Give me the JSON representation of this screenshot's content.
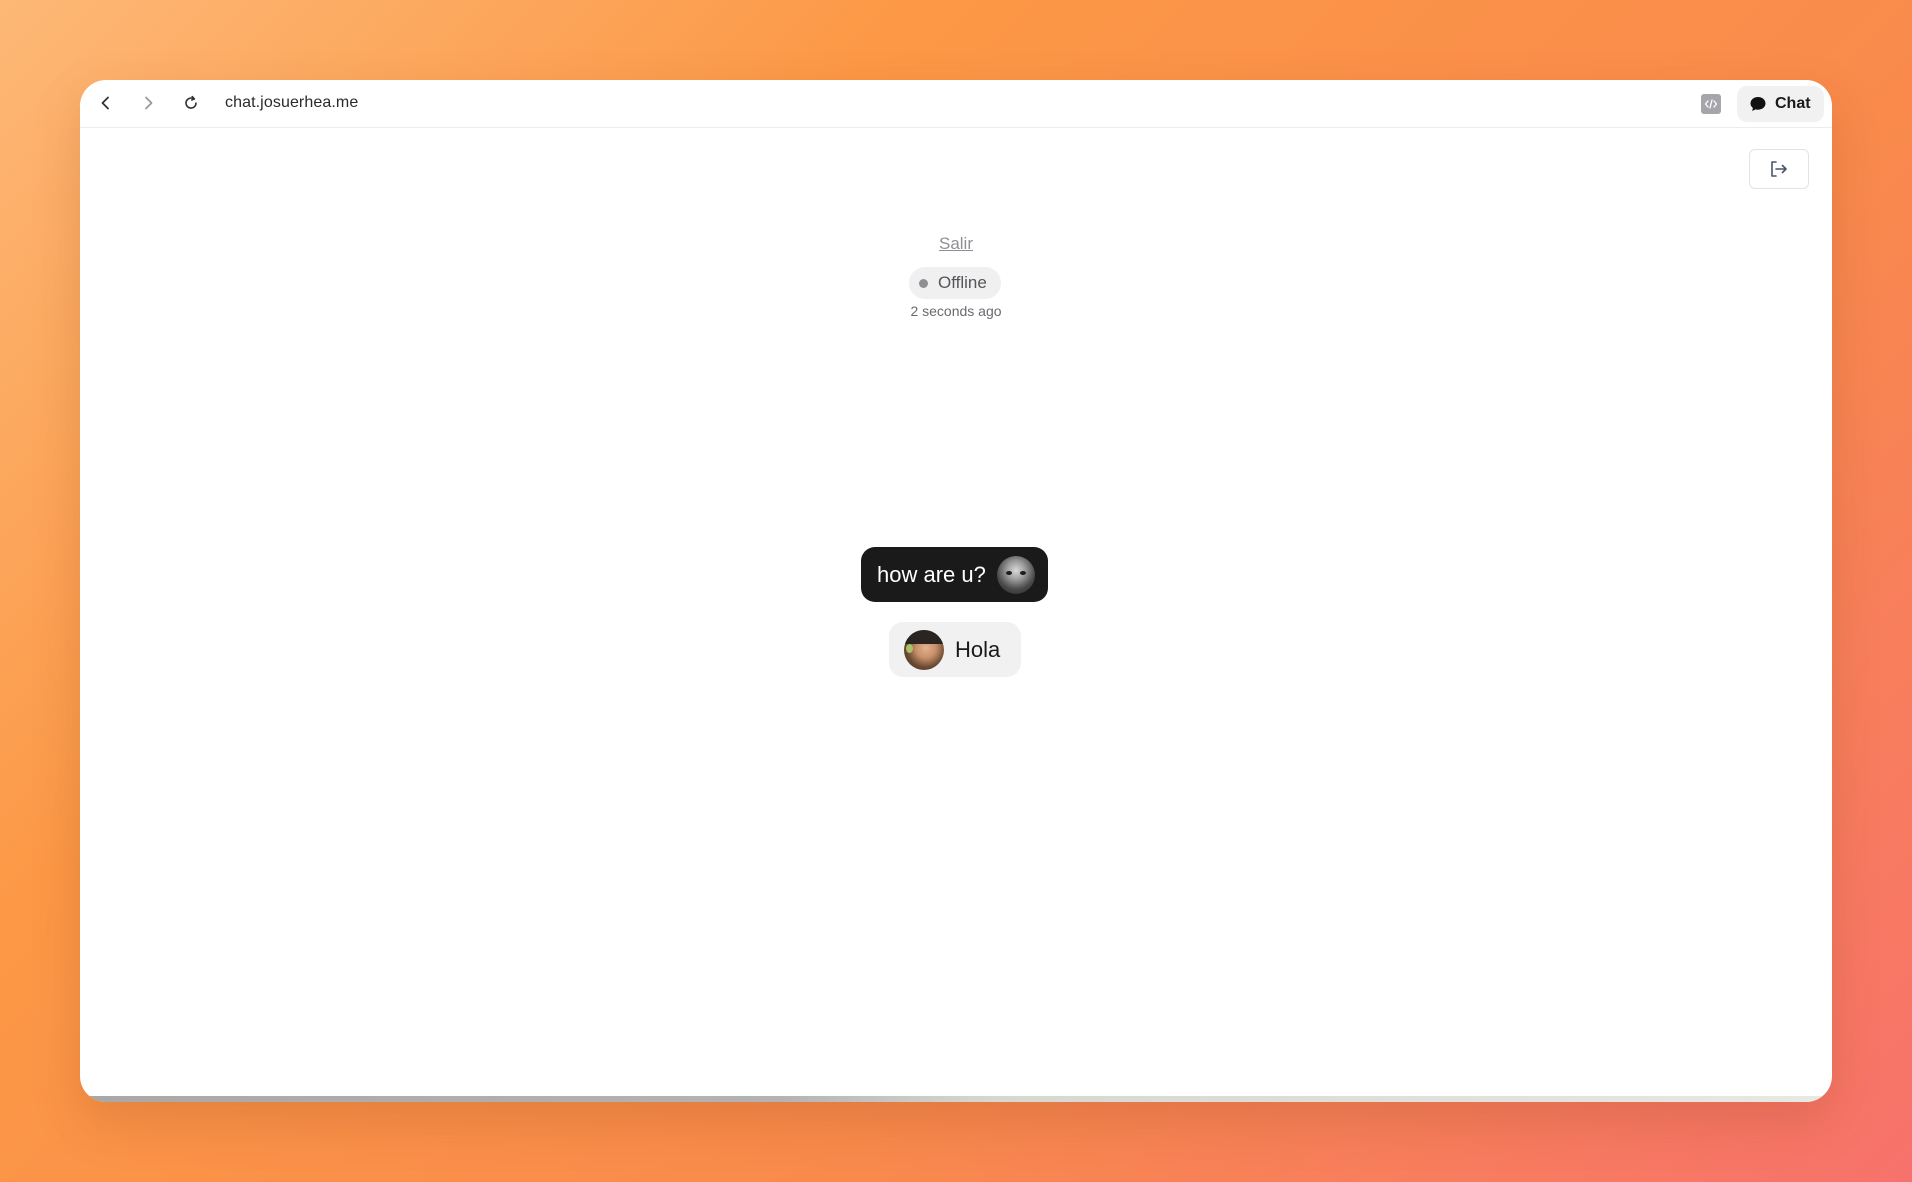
{
  "browser": {
    "url": "chat.josuerhea.me",
    "chat_button_label": "Chat"
  },
  "contact": {
    "name_link": "Salir",
    "status": "Offline",
    "last_seen": "2 seconds ago"
  },
  "messages": [
    {
      "text": "how are u?",
      "style": "dark",
      "avatar": "avatar-grayscale"
    },
    {
      "text": "Hola",
      "style": "light",
      "avatar": "avatar-color"
    }
  ],
  "icons": {
    "back": "chevron-left-icon",
    "forward": "chevron-right-icon",
    "reload": "reload-icon",
    "code": "code-icon",
    "chat": "chat-bubble-icon",
    "logout": "logout-icon"
  },
  "colors": {
    "background_gradient_start": "#fdb876",
    "background_gradient_end": "#f7726c",
    "dark_bubble": "#1a1a1a",
    "light_bubble": "#f1f1f2",
    "status_dot": "#8e8e93"
  }
}
